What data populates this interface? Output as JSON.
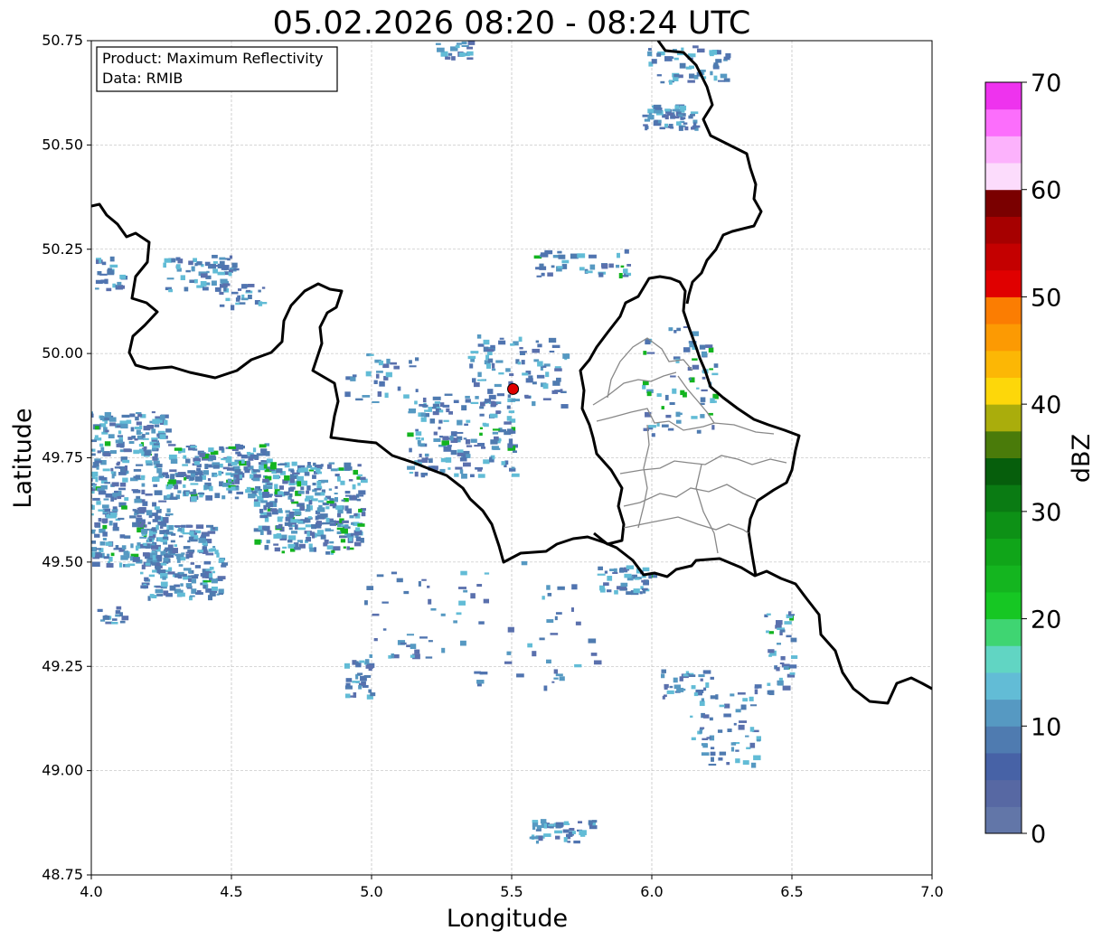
{
  "title": "05.02.2026 08:20 - 08:24 UTC",
  "info": {
    "product": "Product: Maximum Reflectivity",
    "data": "Data: RMIB"
  },
  "axes": {
    "xlabel": "Longitude",
    "ylabel": "Latitude",
    "xlim": [
      4.0,
      7.0
    ],
    "ylim": [
      48.75,
      50.75
    ],
    "xticks": [
      "4.0",
      "4.5",
      "5.0",
      "5.5",
      "6.0",
      "6.5",
      "7.0"
    ],
    "yticks": [
      "48.75",
      "49.00",
      "49.25",
      "49.50",
      "49.75",
      "50.00",
      "50.25",
      "50.50",
      "50.75"
    ],
    "grid": true
  },
  "colorbar": {
    "label": "dBZ",
    "min": 0,
    "max": 70,
    "ticks": [
      "0",
      "10",
      "20",
      "30",
      "40",
      "50",
      "60",
      "70"
    ],
    "colors": [
      "#6276a8",
      "#5768a3",
      "#4762a6",
      "#4f7bb0",
      "#5699c2",
      "#62bcd6",
      "#61d5c3",
      "#3fd572",
      "#16c723",
      "#14b51f",
      "#10a519",
      "#0d9116",
      "#0a7b13",
      "#065e0c",
      "#4a7b0a",
      "#aaad0c",
      "#fdd70a",
      "#fcb705",
      "#fc9a03",
      "#fb7d02",
      "#e00000",
      "#c40000",
      "#a60000",
      "#7a0000",
      "#fcdcfc",
      "#fcb2fc",
      "#fc6efc",
      "#ee33ee"
    ]
  },
  "radar_site": {
    "lon": 5.505,
    "lat": 49.915,
    "color": "#e00000"
  },
  "colors": {
    "echo_weak": "#5074b0",
    "echo_mid": "#62bcd6",
    "echo_strong": "#13b41f",
    "border": "#000000",
    "admin": "#888888"
  }
}
